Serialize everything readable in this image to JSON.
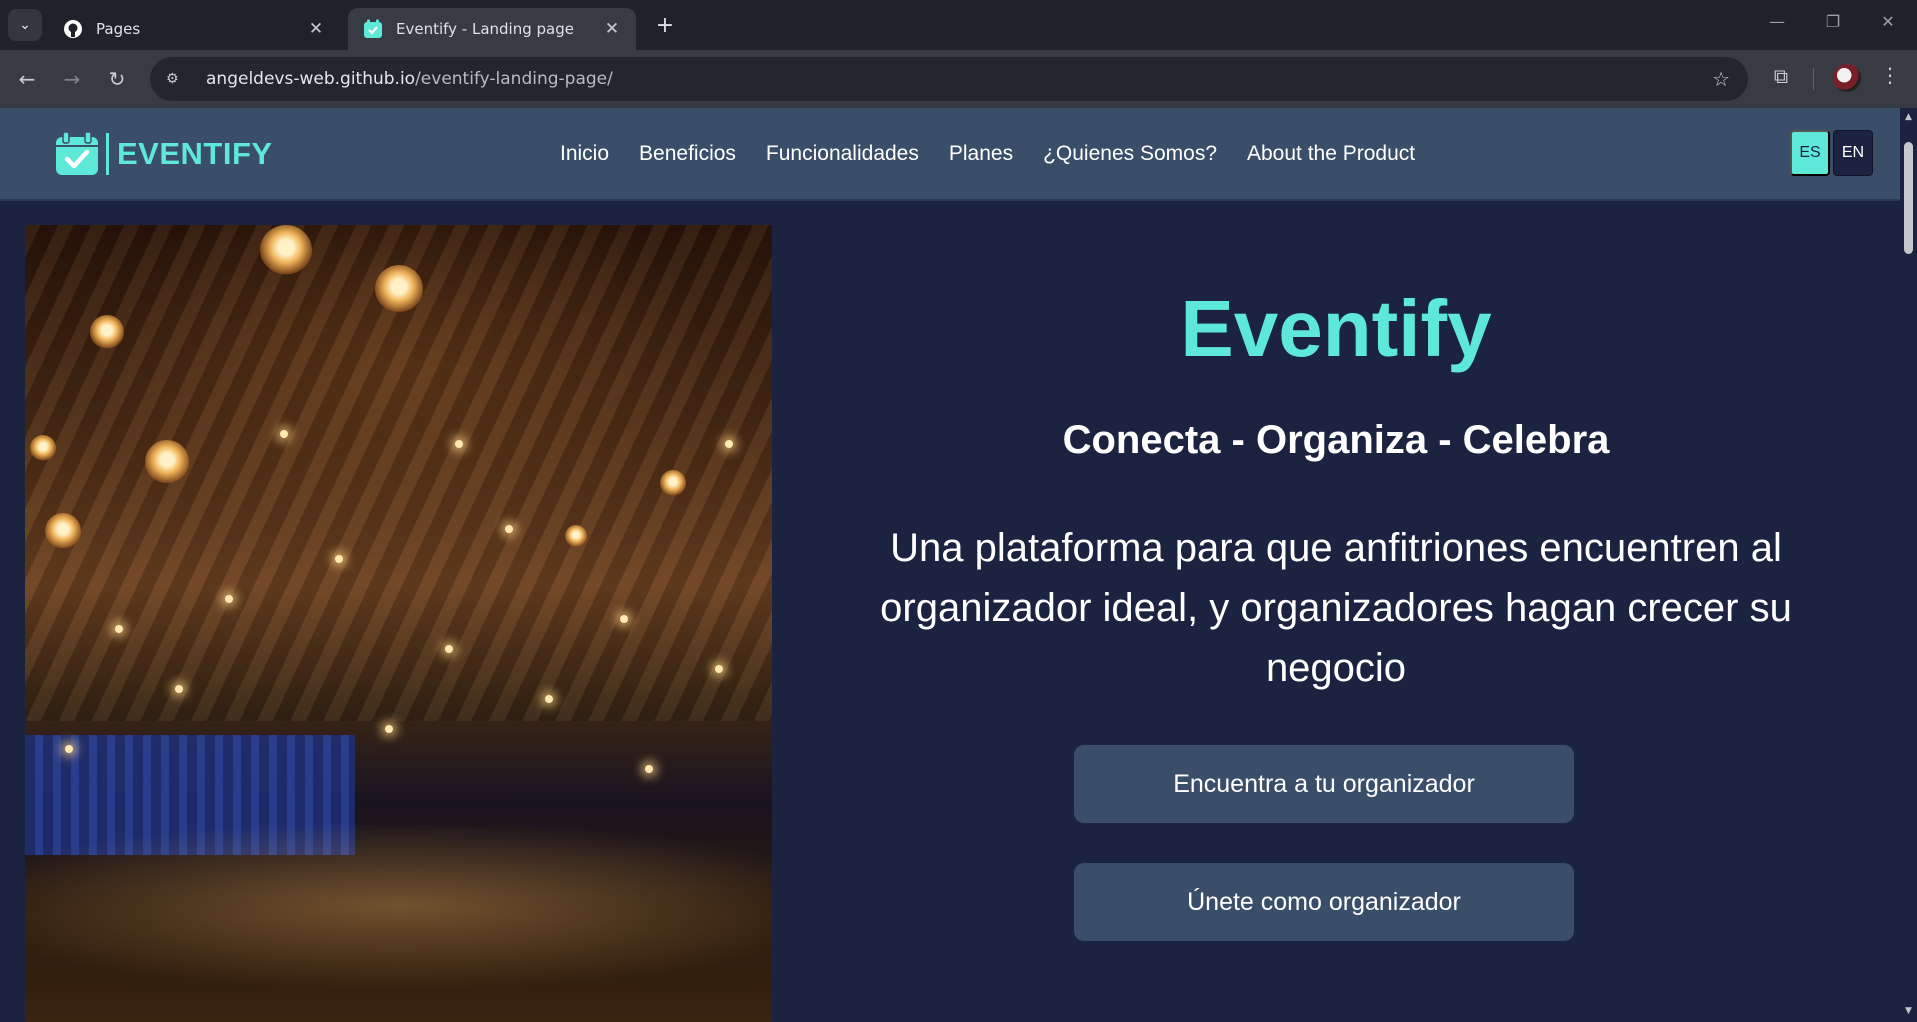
{
  "browser": {
    "tabs": [
      {
        "title": "Pages",
        "icon": "github-icon",
        "active": false
      },
      {
        "title": "Eventify - Landing page",
        "icon": "calendar-check-icon",
        "active": true
      }
    ],
    "url_host": "angeldevs-web.github.io",
    "url_path": "/eventify-landing-page/"
  },
  "header": {
    "brand": "EVENTIFY",
    "nav": [
      "Inicio",
      "Beneficios",
      "Funcionalidades",
      "Planes",
      "¿Quienes Somos?",
      "About the Product"
    ],
    "lang_es": "ES",
    "lang_en": "EN"
  },
  "hero": {
    "title": "Eventify",
    "tagline": "Conecta - Organiza - Celebra",
    "description": "Una plataforma para que anfitriones encuentren al organizador ideal, y organizadores hagan crecer su negocio",
    "cta_primary": "Encuentra a tu organizador",
    "cta_secondary": "Únete como organizador"
  },
  "colors": {
    "accent": "#5de8d7",
    "header_bg": "#3a4e69",
    "page_bg": "#1c2340"
  }
}
